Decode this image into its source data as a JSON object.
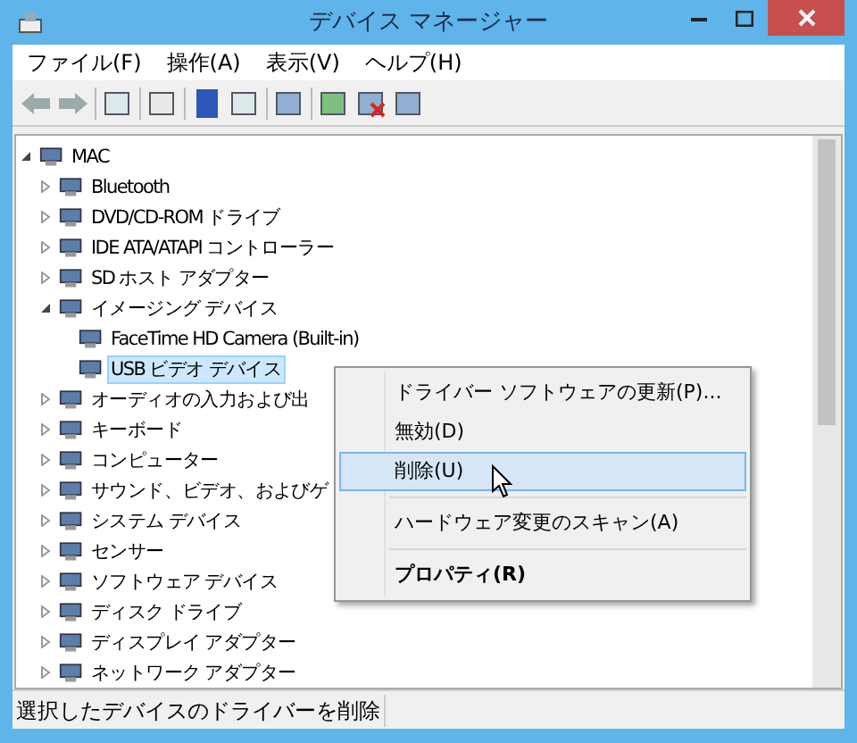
{
  "window": {
    "title": "デバイス マネージャー"
  },
  "menu": [
    "ファイル(F)",
    "操作(A)",
    "表示(V)",
    "ヘルプ(H)"
  ],
  "tree": {
    "label": "MAC",
    "expanded": true,
    "selected": false,
    "children": [
      {
        "label": "Bluetooth",
        "expanded": false,
        "selected": false
      },
      {
        "label": "DVD/CD-ROM ドライブ",
        "expanded": false,
        "selected": false
      },
      {
        "label": "IDE ATA/ATAPI コントローラー",
        "expanded": false,
        "selected": false
      },
      {
        "label": "SD ホスト アダプター",
        "expanded": false,
        "selected": false
      },
      {
        "label": "イメージング デバイス",
        "expanded": true,
        "selected": false,
        "children": [
          {
            "label": "FaceTime HD Camera (Built-in)",
            "selected": false
          },
          {
            "label": "USB ビデオ デバイス",
            "selected": true
          }
        ]
      },
      {
        "label": "オーディオの入力および出",
        "expanded": false,
        "selected": false
      },
      {
        "label": "キーボード",
        "expanded": false,
        "selected": false
      },
      {
        "label": "コンピューター",
        "expanded": false,
        "selected": false
      },
      {
        "label": "サウンド、ビデオ、およびゲ",
        "expanded": false,
        "selected": false
      },
      {
        "label": "システム デバイス",
        "expanded": false,
        "selected": false
      },
      {
        "label": "センサー",
        "expanded": false,
        "selected": false
      },
      {
        "label": "ソフトウェア デバイス",
        "expanded": false,
        "selected": false
      },
      {
        "label": "ディスク ドライブ",
        "expanded": false,
        "selected": false
      },
      {
        "label": "ディスプレイ アダプター",
        "expanded": false,
        "selected": false
      },
      {
        "label": "ネットワーク アダプター",
        "expanded": false,
        "selected": false
      }
    ]
  },
  "context_menu": [
    {
      "kind": "item",
      "label": "ドライバー ソフトウェアの更新(P)...",
      "selected": false,
      "bold": false
    },
    {
      "kind": "item",
      "label": "無効(D)",
      "selected": false,
      "bold": false
    },
    {
      "kind": "item",
      "label": "削除(U)",
      "selected": true,
      "bold": false
    },
    {
      "kind": "separator"
    },
    {
      "kind": "item",
      "label": "ハードウェア変更のスキャン(A)",
      "selected": false,
      "bold": false
    },
    {
      "kind": "separator"
    },
    {
      "kind": "item",
      "label": "プロパティ(R)",
      "selected": false,
      "bold": true
    }
  ],
  "status_bar": "選択したデバイスのドライバーを削除"
}
